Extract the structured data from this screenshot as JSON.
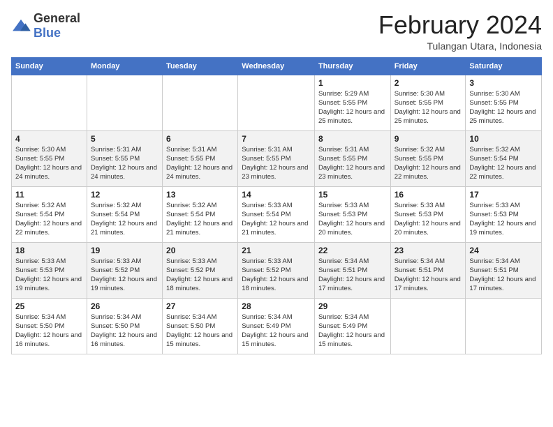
{
  "logo": {
    "general": "General",
    "blue": "Blue"
  },
  "title": "February 2024",
  "subtitle": "Tulangan Utara, Indonesia",
  "days_header": [
    "Sunday",
    "Monday",
    "Tuesday",
    "Wednesday",
    "Thursday",
    "Friday",
    "Saturday"
  ],
  "weeks": [
    [
      {
        "day": "",
        "info": ""
      },
      {
        "day": "",
        "info": ""
      },
      {
        "day": "",
        "info": ""
      },
      {
        "day": "",
        "info": ""
      },
      {
        "day": "1",
        "info": "Sunrise: 5:29 AM\nSunset: 5:55 PM\nDaylight: 12 hours and 25 minutes."
      },
      {
        "day": "2",
        "info": "Sunrise: 5:30 AM\nSunset: 5:55 PM\nDaylight: 12 hours and 25 minutes."
      },
      {
        "day": "3",
        "info": "Sunrise: 5:30 AM\nSunset: 5:55 PM\nDaylight: 12 hours and 25 minutes."
      }
    ],
    [
      {
        "day": "4",
        "info": "Sunrise: 5:30 AM\nSunset: 5:55 PM\nDaylight: 12 hours and 24 minutes."
      },
      {
        "day": "5",
        "info": "Sunrise: 5:31 AM\nSunset: 5:55 PM\nDaylight: 12 hours and 24 minutes."
      },
      {
        "day": "6",
        "info": "Sunrise: 5:31 AM\nSunset: 5:55 PM\nDaylight: 12 hours and 24 minutes."
      },
      {
        "day": "7",
        "info": "Sunrise: 5:31 AM\nSunset: 5:55 PM\nDaylight: 12 hours and 23 minutes."
      },
      {
        "day": "8",
        "info": "Sunrise: 5:31 AM\nSunset: 5:55 PM\nDaylight: 12 hours and 23 minutes."
      },
      {
        "day": "9",
        "info": "Sunrise: 5:32 AM\nSunset: 5:55 PM\nDaylight: 12 hours and 22 minutes."
      },
      {
        "day": "10",
        "info": "Sunrise: 5:32 AM\nSunset: 5:54 PM\nDaylight: 12 hours and 22 minutes."
      }
    ],
    [
      {
        "day": "11",
        "info": "Sunrise: 5:32 AM\nSunset: 5:54 PM\nDaylight: 12 hours and 22 minutes."
      },
      {
        "day": "12",
        "info": "Sunrise: 5:32 AM\nSunset: 5:54 PM\nDaylight: 12 hours and 21 minutes."
      },
      {
        "day": "13",
        "info": "Sunrise: 5:32 AM\nSunset: 5:54 PM\nDaylight: 12 hours and 21 minutes."
      },
      {
        "day": "14",
        "info": "Sunrise: 5:33 AM\nSunset: 5:54 PM\nDaylight: 12 hours and 21 minutes."
      },
      {
        "day": "15",
        "info": "Sunrise: 5:33 AM\nSunset: 5:53 PM\nDaylight: 12 hours and 20 minutes."
      },
      {
        "day": "16",
        "info": "Sunrise: 5:33 AM\nSunset: 5:53 PM\nDaylight: 12 hours and 20 minutes."
      },
      {
        "day": "17",
        "info": "Sunrise: 5:33 AM\nSunset: 5:53 PM\nDaylight: 12 hours and 19 minutes."
      }
    ],
    [
      {
        "day": "18",
        "info": "Sunrise: 5:33 AM\nSunset: 5:53 PM\nDaylight: 12 hours and 19 minutes."
      },
      {
        "day": "19",
        "info": "Sunrise: 5:33 AM\nSunset: 5:52 PM\nDaylight: 12 hours and 19 minutes."
      },
      {
        "day": "20",
        "info": "Sunrise: 5:33 AM\nSunset: 5:52 PM\nDaylight: 12 hours and 18 minutes."
      },
      {
        "day": "21",
        "info": "Sunrise: 5:33 AM\nSunset: 5:52 PM\nDaylight: 12 hours and 18 minutes."
      },
      {
        "day": "22",
        "info": "Sunrise: 5:34 AM\nSunset: 5:51 PM\nDaylight: 12 hours and 17 minutes."
      },
      {
        "day": "23",
        "info": "Sunrise: 5:34 AM\nSunset: 5:51 PM\nDaylight: 12 hours and 17 minutes."
      },
      {
        "day": "24",
        "info": "Sunrise: 5:34 AM\nSunset: 5:51 PM\nDaylight: 12 hours and 17 minutes."
      }
    ],
    [
      {
        "day": "25",
        "info": "Sunrise: 5:34 AM\nSunset: 5:50 PM\nDaylight: 12 hours and 16 minutes."
      },
      {
        "day": "26",
        "info": "Sunrise: 5:34 AM\nSunset: 5:50 PM\nDaylight: 12 hours and 16 minutes."
      },
      {
        "day": "27",
        "info": "Sunrise: 5:34 AM\nSunset: 5:50 PM\nDaylight: 12 hours and 15 minutes."
      },
      {
        "day": "28",
        "info": "Sunrise: 5:34 AM\nSunset: 5:49 PM\nDaylight: 12 hours and 15 minutes."
      },
      {
        "day": "29",
        "info": "Sunrise: 5:34 AM\nSunset: 5:49 PM\nDaylight: 12 hours and 15 minutes."
      },
      {
        "day": "",
        "info": ""
      },
      {
        "day": "",
        "info": ""
      }
    ]
  ]
}
